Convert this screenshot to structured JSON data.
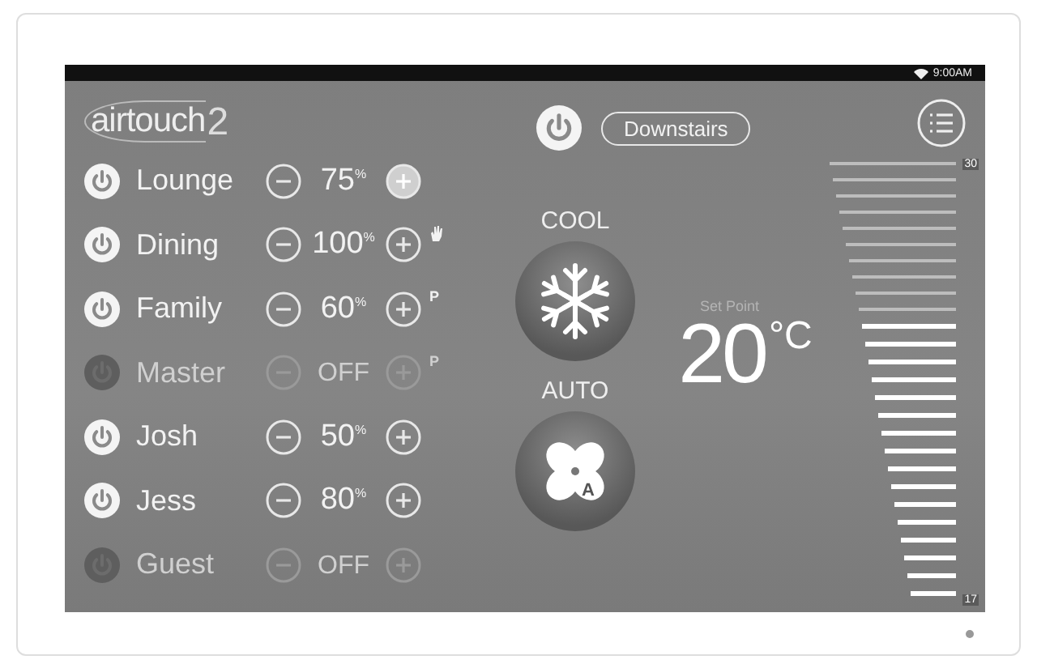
{
  "status_bar": {
    "time": "9:00AM"
  },
  "logo": {
    "text": "airtouch",
    "mark": "2"
  },
  "header": {
    "group_button": "Downstairs",
    "power_on": true
  },
  "zones": [
    {
      "name": "Lounge",
      "on": true,
      "value": "75",
      "unit": "%",
      "plus_pressed": true
    },
    {
      "name": "Dining",
      "on": true,
      "value": "100",
      "unit": "%",
      "plus_pressed": false,
      "marker": {
        "kind": "hand"
      }
    },
    {
      "name": "Family",
      "on": true,
      "value": "60",
      "unit": "%",
      "plus_pressed": false,
      "marker": {
        "kind": "letter",
        "text": "P"
      }
    },
    {
      "name": "Master",
      "on": false,
      "value": "OFF",
      "plus_pressed": false,
      "marker": {
        "kind": "letter",
        "text": "P"
      }
    },
    {
      "name": "Josh",
      "on": true,
      "value": "50",
      "unit": "%",
      "plus_pressed": false
    },
    {
      "name": "Jess",
      "on": true,
      "value": "80",
      "unit": "%",
      "plus_pressed": false
    },
    {
      "name": "Guest",
      "on": false,
      "value": "OFF",
      "plus_pressed": false
    }
  ],
  "modes": [
    {
      "kind": "cool",
      "label": "COOL"
    },
    {
      "kind": "fan_auto",
      "label": "AUTO",
      "badge": "A"
    }
  ],
  "setpoint": {
    "label": "Set Point",
    "value": "20",
    "unit": "°C"
  },
  "scale": {
    "max_label": "30",
    "min_label": "17",
    "level": 0.62
  }
}
